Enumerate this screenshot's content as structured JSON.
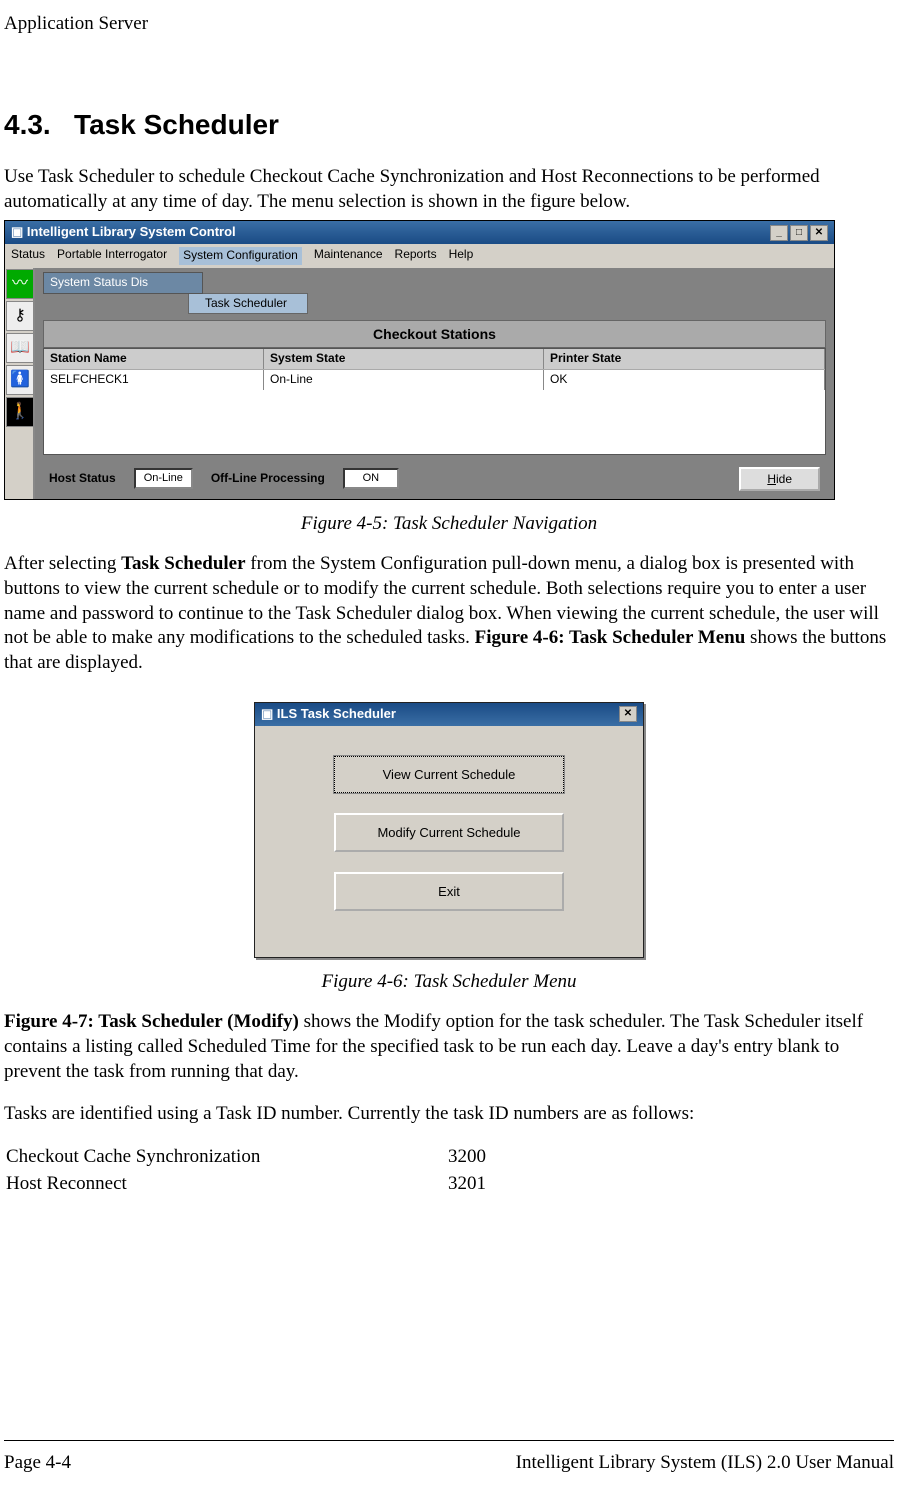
{
  "header": {
    "title": "Application Server"
  },
  "section": {
    "number": "4.3.",
    "title": "Task Scheduler",
    "intro": "Use Task Scheduler to schedule Checkout Cache Synchronization and Host Reconnections to be performed automatically at any time of day. The menu selection is shown in the figure below."
  },
  "figure1": {
    "window_title": "Intelligent Library System Control",
    "menus": {
      "status": "Status",
      "portable": "Portable Interrogator",
      "sysconfig": "System Configuration",
      "maintenance": "Maintenance",
      "reports": "Reports",
      "help": "Help"
    },
    "subwindow_title": "System Status Dis",
    "dropdown_item": "Task Scheduler",
    "checkout_title": "Checkout Stations",
    "cols": {
      "c1": "Station Name",
      "c2": "System State",
      "c3": "Printer State"
    },
    "row1": {
      "c1": "SELFCHECK1",
      "c2": "On-Line",
      "c3": "OK"
    },
    "hostStatus_label": "Host Status",
    "hostStatus_value": "On-Line",
    "offline_label": "Off-Line Processing",
    "offline_value": "ON",
    "hide_prefix": "H",
    "hide_suffix": "ide",
    "caption": "Figure 4-5: Task Scheduler Navigation"
  },
  "para2": {
    "pre": "After selecting ",
    "bold1": "Task Scheduler",
    "middle": " from the System Configuration pull-down menu, a dialog box is presented with buttons to view the current schedule or to modify the current schedule. Both selections require you to enter a user name and password to continue to the Task Scheduler dialog box. When viewing the current schedule, the user will not be able to make any modifications to the scheduled tasks. ",
    "bold2": "Figure 4-6: Task Scheduler Menu",
    "post": " shows the buttons that are displayed."
  },
  "figure2": {
    "title": "ILS Task Scheduler",
    "btn_view": "View Current Schedule",
    "btn_modify": "Modify Current Schedule",
    "btn_exit": "Exit",
    "caption": "Figure 4-6: Task Scheduler Menu"
  },
  "para3": {
    "bold": "Figure 4-7: Task Scheduler (Modify)",
    "rest": " shows the Modify option for the task scheduler. The Task Scheduler itself contains a listing called Scheduled Time for the specified task to be run each day. Leave a day's entry blank to prevent the task from running that day."
  },
  "para4": "Tasks are identified using a Task ID number. Currently the task ID numbers are as follows:",
  "tasks": {
    "r1": {
      "name": "Checkout Cache Synchronization",
      "id": "3200"
    },
    "r2": {
      "name": "Host Reconnect",
      "id": "3201"
    }
  },
  "footer": {
    "page": "Page 4-4",
    "manual": "Intelligent Library System (ILS) 2.0 User Manual"
  }
}
